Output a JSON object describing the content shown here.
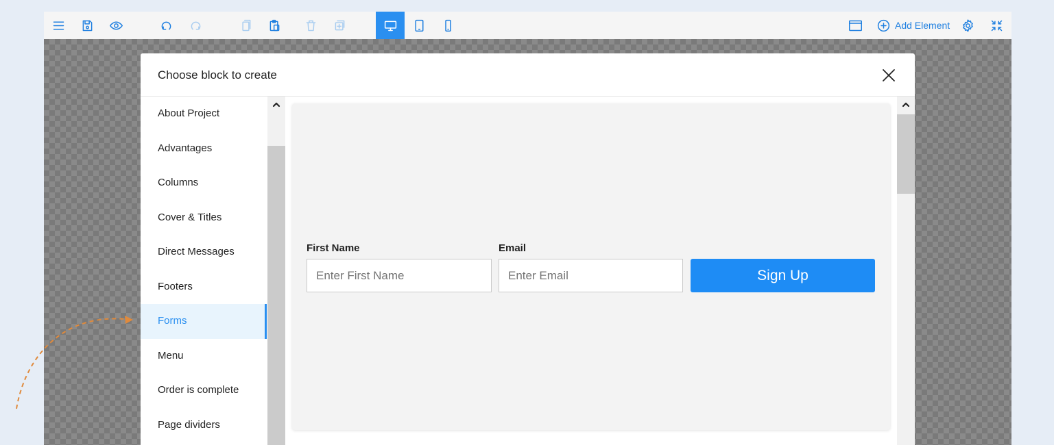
{
  "toolbar": {
    "icons": {
      "menu": "menu-icon",
      "save": "save-icon",
      "preview": "eye-icon",
      "undo": "undo-icon",
      "redo": "redo-icon",
      "copy": "copy-icon",
      "paste": "paste-icon",
      "delete": "trash-icon",
      "duplicate": "duplicate-icon",
      "desktop": "desktop-icon",
      "tablet": "tablet-icon",
      "mobile": "mobile-icon",
      "window": "window-icon",
      "add": "plus-circle-icon",
      "settings": "gear-icon",
      "collapse": "collapse-icon"
    },
    "add_element_label": "Add Element",
    "active_device": "desktop"
  },
  "modal": {
    "title": "Choose block to create",
    "close_icon": "close-icon",
    "categories": [
      "About Project",
      "Advantages",
      "Columns",
      "Cover & Titles",
      "Direct Messages",
      "Footers",
      "Forms",
      "Menu",
      "Order is complete",
      "Page dividers"
    ],
    "selected_category": "Forms"
  },
  "preview": {
    "first_name_label": "First Name",
    "first_name_placeholder": "Enter First Name",
    "email_label": "Email",
    "email_placeholder": "Enter Email",
    "signup_label": "Sign Up"
  },
  "colors": {
    "accent": "#2a8ff0",
    "button": "#1e8cf5",
    "selected_bg": "#e8f4fd",
    "hint_arrow": "#e08a3c"
  }
}
